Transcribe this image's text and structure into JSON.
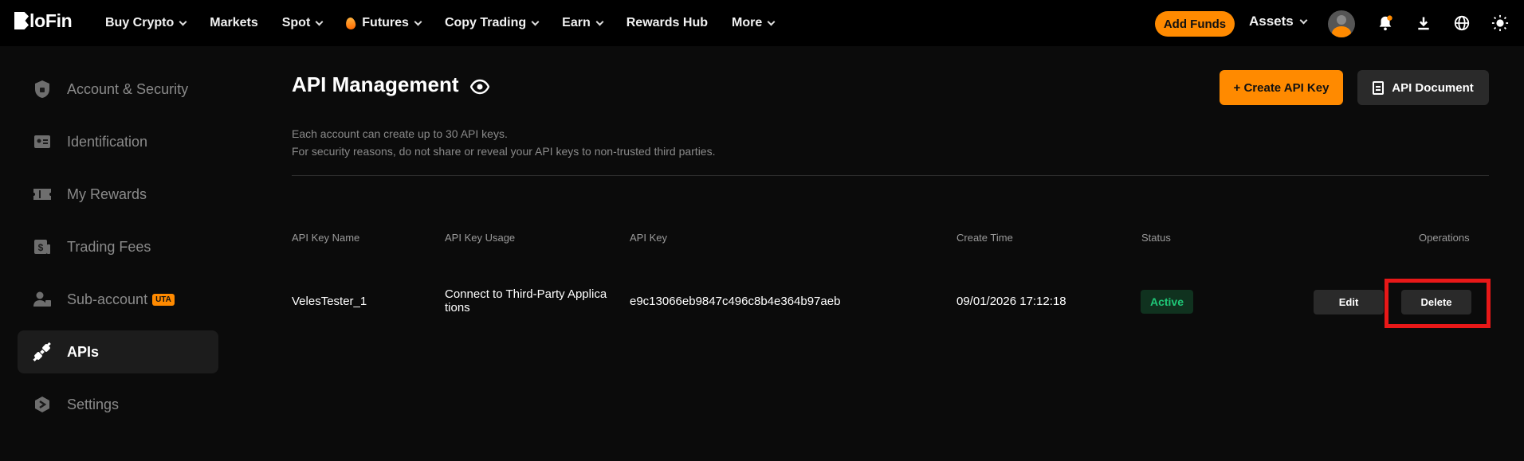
{
  "brand": {
    "logo_text": "BloFin"
  },
  "nav": {
    "items": [
      {
        "label": "Buy Crypto",
        "dropdown": true
      },
      {
        "label": "Markets",
        "dropdown": false
      },
      {
        "label": "Spot",
        "dropdown": true
      },
      {
        "label": "Futures",
        "dropdown": true,
        "icon": "flame-icon"
      },
      {
        "label": "Copy Trading",
        "dropdown": true
      },
      {
        "label": "Earn",
        "dropdown": true
      },
      {
        "label": "Rewards Hub",
        "dropdown": false
      },
      {
        "label": "More",
        "dropdown": true
      }
    ]
  },
  "topright": {
    "add_funds": "Add Funds",
    "assets": "Assets",
    "icons": [
      "avatar",
      "bell-icon",
      "download-icon",
      "globe-icon",
      "sun-icon"
    ]
  },
  "sidebar": {
    "items": [
      {
        "label": "Account & Security",
        "icon": "shield-icon",
        "active": false
      },
      {
        "label": "Identification",
        "icon": "id-card-icon",
        "active": false
      },
      {
        "label": "My Rewards",
        "icon": "ticket-icon",
        "active": false
      },
      {
        "label": "Trading Fees",
        "icon": "fee-icon",
        "active": false
      },
      {
        "label": "Sub-account",
        "icon": "sub-account-icon",
        "active": false,
        "badge": "UTA"
      },
      {
        "label": "APIs",
        "icon": "plug-icon",
        "active": true
      },
      {
        "label": "Settings",
        "icon": "settings-icon",
        "active": false
      }
    ]
  },
  "main": {
    "title": "API Management",
    "create_button": "+ Create API Key",
    "doc_button": "API Document",
    "info_line1": "Each account can create up to 30 API keys.",
    "info_line2": "For security reasons, do not share or reveal your API keys to non-trusted third parties."
  },
  "table": {
    "headers": [
      "API Key Name",
      "API Key Usage",
      "API Key",
      "Create Time",
      "Status",
      "Operations"
    ],
    "rows": [
      {
        "name": "VelesTester_1",
        "usage_line1": "Connect to Third-Party Applica",
        "usage_line2": "tions",
        "key": "e9c13066eb9847c496c8b4e364b97aeb",
        "create_time": "09/01/2026 17:12:18",
        "status": "Active",
        "edit": "Edit",
        "delete": "Delete"
      }
    ]
  },
  "colors": {
    "accent": "#ff8a00",
    "background": "#0b0b0b",
    "status_active": "#1fc878",
    "highlight": "#e81818"
  }
}
